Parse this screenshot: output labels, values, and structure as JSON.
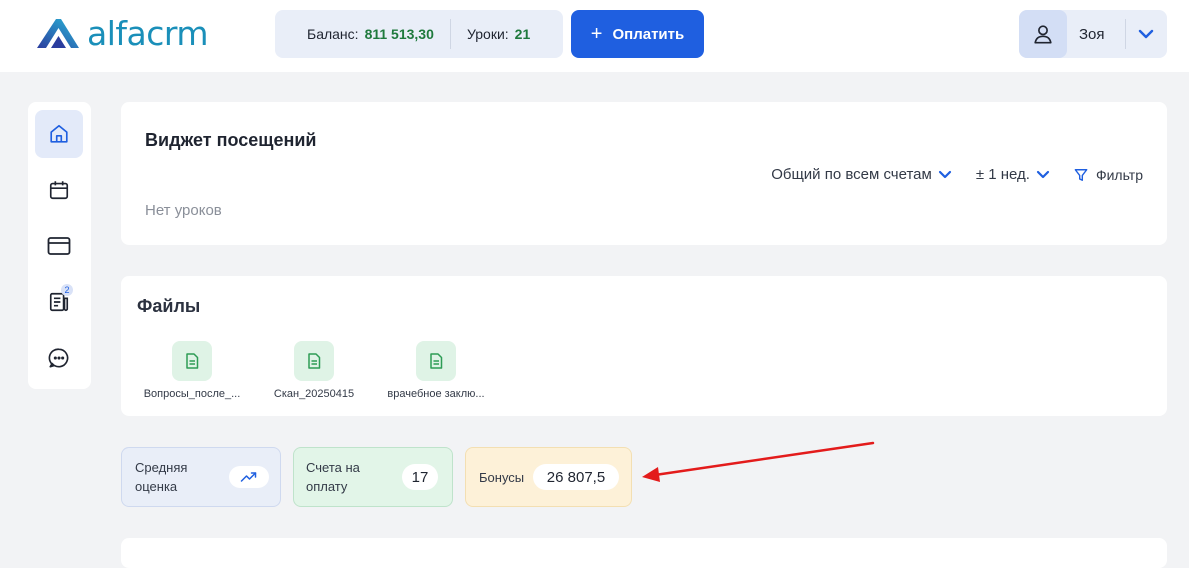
{
  "header": {
    "logo_text": "alfacrm",
    "balance_label": "Баланс:",
    "balance_value": "811 513,30",
    "lessons_label": "Уроки:",
    "lessons_value": "21",
    "pay_label": "Оплатить",
    "user_name": "Зоя"
  },
  "sidebar": {
    "items": [
      {
        "icon": "home-icon",
        "active": true
      },
      {
        "icon": "calendar-icon"
      },
      {
        "icon": "card-icon"
      },
      {
        "icon": "document-list-icon",
        "badge": "2"
      },
      {
        "icon": "chat-icon"
      }
    ]
  },
  "visits_widget": {
    "title": "Виджет посещений",
    "account_select": "Общий по всем счетам",
    "period_select": "± 1 нед.",
    "filter_label": "Фильтр",
    "empty_text": "Нет уроков"
  },
  "files": {
    "title": "Файлы",
    "items": [
      {
        "name": "Вопросы_после_..."
      },
      {
        "name": "Скан_20250415"
      },
      {
        "name": "врачебное заклю..."
      }
    ]
  },
  "stats": {
    "avg_label_1": "Средняя",
    "avg_label_2": "оценка",
    "bills_label_1": "Счета на",
    "bills_label_2": "оплату",
    "bills_value": "17",
    "bonus_label": "Бонусы",
    "bonus_value": "26 807,5"
  },
  "colors": {
    "primary": "#1f5fe0",
    "green_value": "#1f7a3d",
    "annotation_arrow": "#e31b1b"
  }
}
